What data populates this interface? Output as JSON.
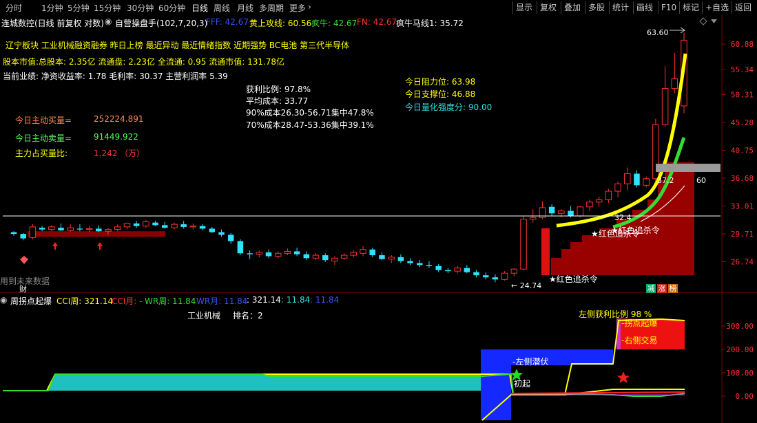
{
  "toolbar": {
    "periods": [
      "分时",
      "1分钟",
      "5分钟",
      "15分钟",
      "30分钟",
      "60分钟",
      "日线",
      "周线",
      "月线",
      "多周期",
      "更多"
    ],
    "active_period": "日线",
    "more_arrow": "›",
    "actions": [
      "显示",
      "复权",
      "叠加",
      "多股",
      "统计",
      "画线",
      "F10",
      "标记",
      "+自选",
      "返回"
    ]
  },
  "header": {
    "stock": "连城数控(日线 前复权 对数)",
    "indicator_name": "自营操盘手(102,7,20,3)",
    "fff": "FFF: 42.67",
    "yellow_line": "黄上攻线: 60.56",
    "mad_bull": "疯牛: 42.67",
    "fn": "FN: 42.67",
    "mad_bull_ma": "疯牛马线1: 35.72"
  },
  "info": {
    "concepts": "辽宁板块  工业机械融资融券 昨日上榜 最近异动 最近情绪指数 近期强势  BC电池 第三代半导体",
    "shares": "股本市值:总股本: 2.35亿 流通盘: 2.23亿 全流通: 0.95 流通市值: 131.78亿",
    "earnings": "当前业绩: 净资收益率: 1.78 毛利率: 30.37 主营利润率 5.39",
    "buy_label": "今日主动买量=",
    "buy_value": "252224.891",
    "sell_label": "今日主动卖量=",
    "sell_value": "91449.922",
    "ratio_label": "主力占买量比:",
    "ratio_value": "1.242 （万）",
    "profit_ratio": "获利比例: 97.8%",
    "avg_cost": "平均成本: 33.77",
    "cost90": "90%成本26.30-56.71集中47.8%",
    "cost70": "70%成本28.47-53.36集中39.1%",
    "resistance": "今日阻力位: 63.98",
    "support": "今日支撑位: 46.88",
    "strength": "今日量化强度分: 90.00"
  },
  "main_chart": {
    "y_ticks": [
      "60.88",
      "55.34",
      "50.31",
      "45.28",
      "40.75",
      "36.68",
      "33.01",
      "29.71",
      "26.74"
    ],
    "y_range": [
      24.74,
      63.6
    ],
    "high_label": "63.60",
    "low_label": "24.74",
    "mid_label_a": "37.2",
    "mid_label_b": "60",
    "mid_label_c": "32.4",
    "signal_1": "★红色追杀令",
    "signal_2": "★红色追杀令",
    "signal_3": "★红色追杀令",
    "future_data": "用到未来数据",
    "cai": "财",
    "badge_a": "减",
    "badge_b": "涨",
    "badge_c": "榜",
    "colors": {
      "up": "#ff3333",
      "down": "#33e0ff",
      "yellow": "#ffff00",
      "green": "#33cc33",
      "darkred": "#990000"
    },
    "candles": [
      [
        29.9,
        30.0,
        29.5,
        29.7
      ],
      [
        29.7,
        29.8,
        29.0,
        29.2
      ],
      [
        29.3,
        30.8,
        29.1,
        30.5
      ],
      [
        30.4,
        30.6,
        30.0,
        30.2
      ],
      [
        30.2,
        30.7,
        30.0,
        30.5
      ],
      [
        30.4,
        30.9,
        30.0,
        30.1
      ],
      [
        30.1,
        30.8,
        29.9,
        30.4
      ],
      [
        30.3,
        30.8,
        30.0,
        30.2
      ],
      [
        30.2,
        30.6,
        29.9,
        30.3
      ],
      [
        30.3,
        30.7,
        29.9,
        30.0
      ],
      [
        30.0,
        30.4,
        29.6,
        30.2
      ],
      [
        30.2,
        30.8,
        30.0,
        30.5
      ],
      [
        30.5,
        31.0,
        30.2,
        30.9
      ],
      [
        30.9,
        31.2,
        30.4,
        30.6
      ],
      [
        30.6,
        31.3,
        30.4,
        31.1
      ],
      [
        31.0,
        31.2,
        30.6,
        30.7
      ],
      [
        30.7,
        31.1,
        30.3,
        30.4
      ],
      [
        30.4,
        31.0,
        30.2,
        30.8
      ],
      [
        30.8,
        31.2,
        30.3,
        30.5
      ],
      [
        30.5,
        30.9,
        30.2,
        30.6
      ],
      [
        30.6,
        30.8,
        30.1,
        30.3
      ],
      [
        30.3,
        30.5,
        29.8,
        29.9
      ],
      [
        29.9,
        30.2,
        29.4,
        29.6
      ],
      [
        29.6,
        29.8,
        28.6,
        28.9
      ],
      [
        28.9,
        29.1,
        27.4,
        27.6
      ],
      [
        27.6,
        27.9,
        27.0,
        27.5
      ],
      [
        27.5,
        27.9,
        27.2,
        27.7
      ],
      [
        27.7,
        28.0,
        27.1,
        27.3
      ],
      [
        27.3,
        27.8,
        27.1,
        27.6
      ],
      [
        27.6,
        28.1,
        27.4,
        27.8
      ],
      [
        27.8,
        28.2,
        27.3,
        27.5
      ],
      [
        27.5,
        27.8,
        26.9,
        27.1
      ],
      [
        27.1,
        27.6,
        26.9,
        27.4
      ],
      [
        27.4,
        27.6,
        26.7,
        26.9
      ],
      [
        26.8,
        27.3,
        26.4,
        27.1
      ],
      [
        27.1,
        27.6,
        26.9,
        27.4
      ],
      [
        27.4,
        27.9,
        27.2,
        27.7
      ],
      [
        27.6,
        28.4,
        27.3,
        28.0
      ],
      [
        28.0,
        28.2,
        27.2,
        27.4
      ],
      [
        27.4,
        27.7,
        26.9,
        27.0
      ],
      [
        27.0,
        27.4,
        26.6,
        27.2
      ],
      [
        27.2,
        27.5,
        26.6,
        26.8
      ],
      [
        26.8,
        27.1,
        26.4,
        26.6
      ],
      [
        26.6,
        26.9,
        26.2,
        26.4
      ],
      [
        26.4,
        26.8,
        26.1,
        26.3
      ],
      [
        26.3,
        26.5,
        25.7,
        25.9
      ],
      [
        25.9,
        26.1,
        25.6,
        25.8
      ],
      [
        25.8,
        26.3,
        25.6,
        26.1
      ],
      [
        26.1,
        26.4,
        25.6,
        25.7
      ],
      [
        25.7,
        25.9,
        25.2,
        25.4
      ],
      [
        25.4,
        25.7,
        25.0,
        25.2
      ],
      [
        25.2,
        25.5,
        24.74,
        25.0
      ],
      [
        25.0,
        25.8,
        24.9,
        25.6
      ],
      [
        25.6,
        26.1,
        25.3,
        26.0
      ],
      [
        26.0,
        31.8,
        25.9,
        31.4
      ],
      [
        31.4,
        32.6,
        31.0,
        31.6
      ],
      [
        31.6,
        33.6,
        31.4,
        32.8
      ],
      [
        32.9,
        33.2,
        31.8,
        32.1
      ],
      [
        32.1,
        32.6,
        31.6,
        32.4
      ],
      [
        32.4,
        33.0,
        31.6,
        31.8
      ],
      [
        31.8,
        33.0,
        31.6,
        32.9
      ],
      [
        32.9,
        33.8,
        32.4,
        33.5
      ],
      [
        33.5,
        34.2,
        32.9,
        33.8
      ],
      [
        33.8,
        35.2,
        33.4,
        34.9
      ],
      [
        34.9,
        36.2,
        34.1,
        35.9
      ],
      [
        35.9,
        38.2,
        35.0,
        37.3
      ],
      [
        37.3,
        37.8,
        35.4,
        35.7
      ],
      [
        35.7,
        36.9,
        35.4,
        36.6
      ],
      [
        36.6,
        45.9,
        36.2,
        44.9
      ],
      [
        44.9,
        56.0,
        44.5,
        51.5
      ],
      [
        51.5,
        58.9,
        50.6,
        53.4
      ],
      [
        48.2,
        63.6,
        46.88,
        61.8
      ]
    ]
  },
  "sub_chart": {
    "name": "周拐点起爆",
    "cci_week": "CCI周: 321.14",
    "cci_month": "CCI月: -",
    "wr_week": "WR周: 11.84",
    "wr_month": "WR月: 11.84",
    "v1": ": 321.14",
    "v2": ": 11.84",
    "v3": ": 11.84",
    "sector": "工业机械",
    "rank": "排名：2",
    "left_profit": "左侧获利比例 98 %",
    "turn_point": "-拐点起爆",
    "right_trade": "-右侧交易",
    "left_ambush": "-左侧潜伏",
    "initial": "初起",
    "y_ticks": [
      "300.00",
      "200.00",
      "100.00",
      "0.00"
    ]
  }
}
